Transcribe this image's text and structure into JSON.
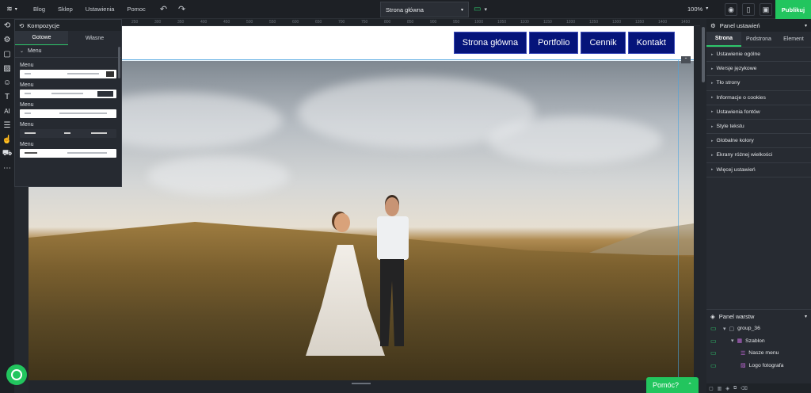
{
  "topbar": {
    "menu": [
      "Blog",
      "Sklep",
      "Ustawienia",
      "Pomoc"
    ],
    "page_select": "Strona główna",
    "zoom": "100%",
    "publish": "Publikuj"
  },
  "compositions": {
    "title": "Kompozycje",
    "tabs": [
      "Gotowe",
      "Własne"
    ],
    "section": "Menu",
    "items": [
      "Menu",
      "Menu",
      "Menu",
      "Menu",
      "Menu"
    ]
  },
  "ruler": [
    "250",
    "300",
    "350",
    "400",
    "450",
    "500",
    "550",
    "600",
    "650",
    "700",
    "750",
    "800",
    "850",
    "900",
    "950",
    "1000",
    "1050",
    "1100",
    "1150",
    "1200",
    "1250",
    "1300",
    "1350",
    "1400",
    "1450"
  ],
  "site": {
    "nav": [
      "Strona główna",
      "Portfolio",
      "Cennik",
      "Kontakt"
    ]
  },
  "settings_panel": {
    "title": "Panel ustawień",
    "tabs": [
      "Strona",
      "Podstrona",
      "Element"
    ],
    "items": [
      "Ustawienie ogólne",
      "Wersje językowe",
      "Tło strony",
      "Informacje o cookies",
      "Ustawienia fontów",
      "Style tekstu",
      "Globalne kolory",
      "Ekrany różnej wielkości",
      "Więcej ustawień"
    ]
  },
  "layers_panel": {
    "title": "Panel warstw",
    "rows": [
      {
        "label": "group_36",
        "icon": "folder-icon"
      },
      {
        "label": "Szablon",
        "icon": "template-icon"
      },
      {
        "label": "Nasze menu",
        "icon": "menu-icon"
      },
      {
        "label": "Logo fotografa",
        "icon": "image-icon"
      }
    ]
  },
  "help": {
    "label": "Pomóc?"
  },
  "colors": {
    "accent": "#22c55e",
    "nav_button": "#05147a",
    "panel": "#272b32"
  }
}
